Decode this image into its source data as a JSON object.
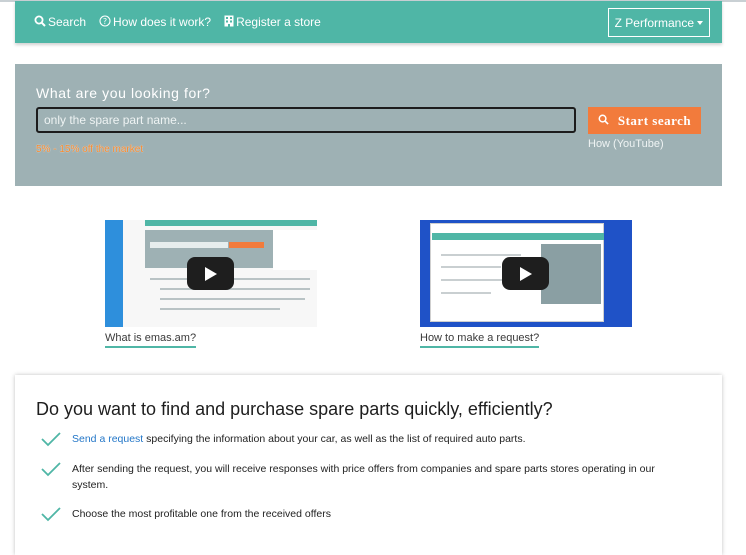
{
  "nav": {
    "search_label": "Search",
    "how_label": "How does it work?",
    "register_label": "Register a store",
    "dropdown_label": "Z Performance"
  },
  "search": {
    "heading": "What are you looking for?",
    "placeholder": "only the spare part name...",
    "button_label": "Start search",
    "discount": "5% - 15% off the market",
    "how_youtube": "How (YouTube)"
  },
  "videos": [
    {
      "caption": "What is emas.am?"
    },
    {
      "caption": "How to make a request?"
    }
  ],
  "info": {
    "title": "Do you want to find and purchase spare parts quickly, efficiently?",
    "items": [
      {
        "link": "Send a request",
        "text": " specifying the information about your car, as well as the list of required auto parts."
      },
      {
        "text": "After sending the request, you will receive responses with price offers from companies and spare parts stores operating in our system."
      },
      {
        "text": "Choose the most profitable one from the received offers"
      }
    ]
  },
  "colors": {
    "navbar": "#4fb6a6",
    "search_panel": "#9eb1b4",
    "accent_orange": "#f27b3c",
    "link_blue": "#2477c8",
    "check_green": "#4fb6a6"
  },
  "icons": {
    "search": "search-icon",
    "help": "help-circle-icon",
    "store": "building-icon",
    "dropdown": "caret-down-icon",
    "check": "check-icon",
    "play": "play-icon"
  }
}
